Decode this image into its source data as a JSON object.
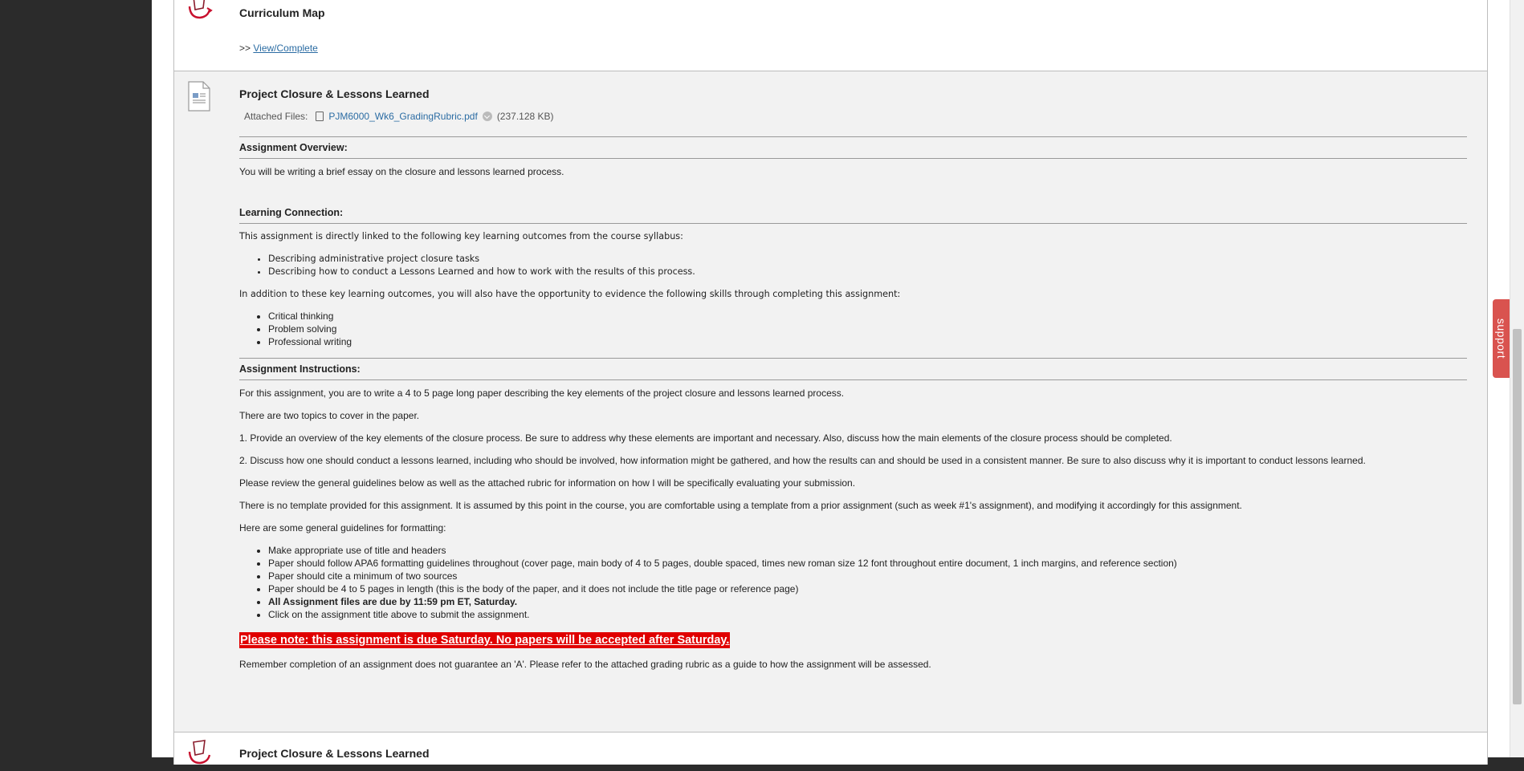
{
  "support_label": "support",
  "curriculum": {
    "title": "Curriculum Map",
    "link_prefix": ">>",
    "link_label": "View/Complete"
  },
  "project": {
    "title": "Project Closure & Lessons Learned",
    "attached_label": "Attached Files:",
    "attached_file_name": "PJM6000_Wk6_GradingRubric.pdf",
    "attached_file_size": "(237.128 KB)",
    "overview_heading": "Assignment Overview:",
    "overview_text": "You will be writing a brief essay on the closure and lessons learned process.",
    "connection_heading": "Learning Connection:",
    "connection_intro": "This assignment is directly linked to the following key learning outcomes from the course syllabus:",
    "outcomes": [
      "Describing administrative project closure tasks",
      "Describing how to conduct a Lessons Learned and how to work with the results of this process."
    ],
    "skills_intro": "In addition to these key learning outcomes, you will also have the opportunity to evidence the following skills through completing this assignment:",
    "skills": [
      "Critical thinking",
      "Problem solving",
      "Professional writing"
    ],
    "instructions_heading": "Assignment Instructions:",
    "instr_1": "For this assignment, you are to write a  4 to 5 page long paper describing the key elements of the project closure and lessons learned process.",
    "instr_2": "There are two topics to cover in the paper.",
    "instr_3": "1. Provide an overview of the key elements of the closure process. Be sure to address why these elements are important and necessary. Also, discuss how the main elements of the closure process should be completed.",
    "instr_4": "2. Discuss how one should conduct a lessons learned, including who should be involved, how information might be gathered, and how the results can and should be used in a consistent manner. Be sure to also discuss why it is important to conduct lessons learned.",
    "instr_5": "Please review the general guidelines below as well as the attached rubric for information on how I will be specifically evaluating your submission.",
    "instr_6": "There is no template provided for this assignment. It is assumed by this point in the course, you are comfortable using a template from a prior assignment (such as week #1's assignment), and modifying it accordingly for this assignment.",
    "instr_7": "Here are some general guidelines for formatting:",
    "guidelines": [
      "Make appropriate use of title and headers",
      "Paper should follow APA6 formatting guidelines throughout (cover page, main body of 4 to 5 pages, double spaced, times new roman size 12 font throughout entire document, 1 inch margins, and reference section)",
      "Paper should cite a minimum of two sources",
      "Paper should be 4 to 5 pages in length (this is the body of the paper, and it does not include the title page or reference page)",
      "All Assignment files are due by 11:59 pm ET, Saturday.",
      "Click on the assignment title above to submit the assignment."
    ],
    "note": "Please note: this assignment is due Saturday. No papers will be accepted after Saturday.",
    "closing": "Remember completion of an assignment does not guarantee an 'A'. Please refer to the attached grading rubric as a guide to how the assignment will be assessed."
  },
  "next_item": {
    "title": "Project Closure & Lessons Learned"
  }
}
